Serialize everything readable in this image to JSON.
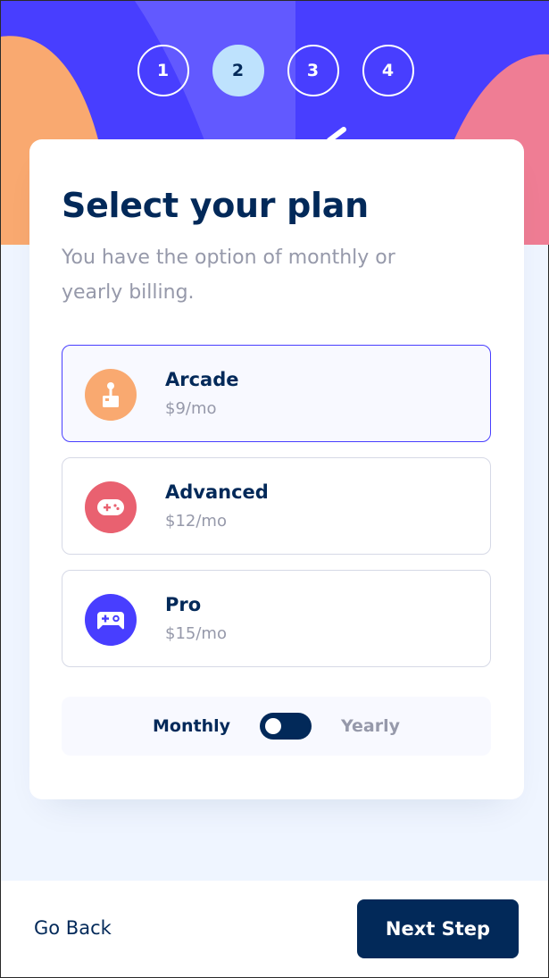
{
  "steps": [
    {
      "number": "1",
      "active": false
    },
    {
      "number": "2",
      "active": true
    },
    {
      "number": "3",
      "active": false
    },
    {
      "number": "4",
      "active": false
    }
  ],
  "form": {
    "title": "Select your plan",
    "subtitle": "You have the option of monthly or yearly billing."
  },
  "plans": [
    {
      "name": "Arcade",
      "price": "$9/mo",
      "icon": "arcade-joystick-icon",
      "color": "#f9a970",
      "selected": true
    },
    {
      "name": "Advanced",
      "price": "$12/mo",
      "icon": "gamepad-icon",
      "color": "#e96170",
      "selected": false
    },
    {
      "name": "Pro",
      "price": "$15/mo",
      "icon": "controller-icon",
      "color": "#483eff",
      "selected": false
    }
  ],
  "billing": {
    "monthly_label": "Monthly",
    "yearly_label": "Yearly",
    "selected": "Monthly"
  },
  "footer": {
    "back_label": "Go Back",
    "next_label": "Next Step"
  },
  "colors": {
    "marine_blue": "#022959",
    "purple": "#483eff",
    "light_blue": "#bee2fd",
    "grey": "#9699aa",
    "border": "#d6d9e6",
    "background": "#eff5ff"
  }
}
